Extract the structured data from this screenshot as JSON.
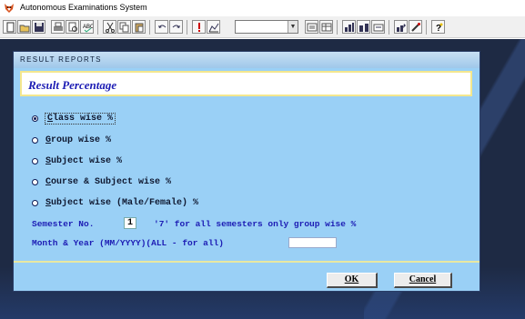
{
  "app": {
    "title": "Autonomous Examinations System",
    "icon": "fox-icon"
  },
  "toolbar": {
    "buttons": [
      "new-icon",
      "open-icon",
      "save-icon",
      "print-icon",
      "print-preview-icon",
      "spell-check-icon",
      "cut-icon",
      "copy-icon",
      "paste-icon",
      "undo-icon",
      "redo-icon",
      "run-icon",
      "chart-icon",
      "form-icon",
      "table-icon",
      "report-icon",
      "label-icon",
      "query-icon",
      "design-icon",
      "help-icon"
    ],
    "combo_value": ""
  },
  "dialog": {
    "header": "RESULT REPORTS",
    "heading": "Result Percentage",
    "options": [
      {
        "hotkey": "C",
        "rest": "lass wise %",
        "selected": true
      },
      {
        "hotkey": "G",
        "rest": "roup wise %",
        "selected": false
      },
      {
        "hotkey": "S",
        "rest": "ubject wise %",
        "selected": false
      },
      {
        "hotkey": "C",
        "rest": "ourse & Subject wise %",
        "selected": false
      },
      {
        "hotkey": "S",
        "rest": "ubject wise (Male/Female) %",
        "selected": false
      }
    ],
    "semester_label": "Semester No.",
    "semester_value": "1",
    "semester_note": "'7' for all semesters only group wise %",
    "month_year_label": "Month & Year (MM/YYYY)(ALL - for all)",
    "month_year_value": "",
    "ok_hotkey": "O",
    "ok_rest": "K",
    "cancel_hotkey": "C",
    "cancel_rest": "ancel"
  },
  "colors": {
    "dialog_bg": "#9ad0f6",
    "workspace_bg": "#1e2a44",
    "heading_text": "#1c1cb4",
    "label_text": "#1c1cb4"
  }
}
